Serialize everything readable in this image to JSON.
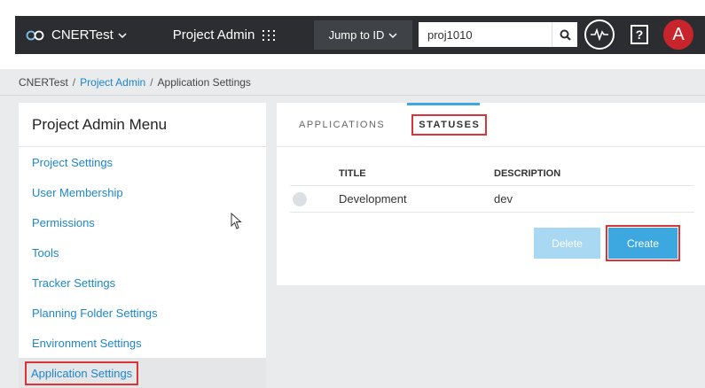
{
  "header": {
    "app_name": "CNERTest",
    "project_admin_label": "Project Admin",
    "jump_label": "Jump to ID",
    "search_value": "proj1010",
    "help_label": "?",
    "avatar_initial": "A"
  },
  "breadcrumb": {
    "root": "CNERTest",
    "sep1": "/",
    "middle": "Project Admin",
    "sep2": "/",
    "current": "Application Settings"
  },
  "sidebar": {
    "title": "Project Admin Menu",
    "items": [
      {
        "label": "Project Settings"
      },
      {
        "label": "User Membership"
      },
      {
        "label": "Permissions"
      },
      {
        "label": "Tools"
      },
      {
        "label": "Tracker Settings"
      },
      {
        "label": "Planning Folder Settings"
      },
      {
        "label": "Environment Settings"
      },
      {
        "label": "Application Settings"
      }
    ]
  },
  "main": {
    "tabs": [
      {
        "label": "APPLICATIONS"
      },
      {
        "label": "STATUSES"
      }
    ],
    "table": {
      "headers": [
        "TITLE",
        "DESCRIPTION"
      ],
      "rows": [
        {
          "title": "Development",
          "description": "dev"
        }
      ]
    },
    "delete_label": "Delete",
    "create_label": "Create"
  },
  "colors": {
    "topbar": "#2b2d30",
    "accent": "#3da8e0",
    "link": "#1d87c9",
    "highlight": "#d9343a",
    "avatar": "#c8242b"
  }
}
